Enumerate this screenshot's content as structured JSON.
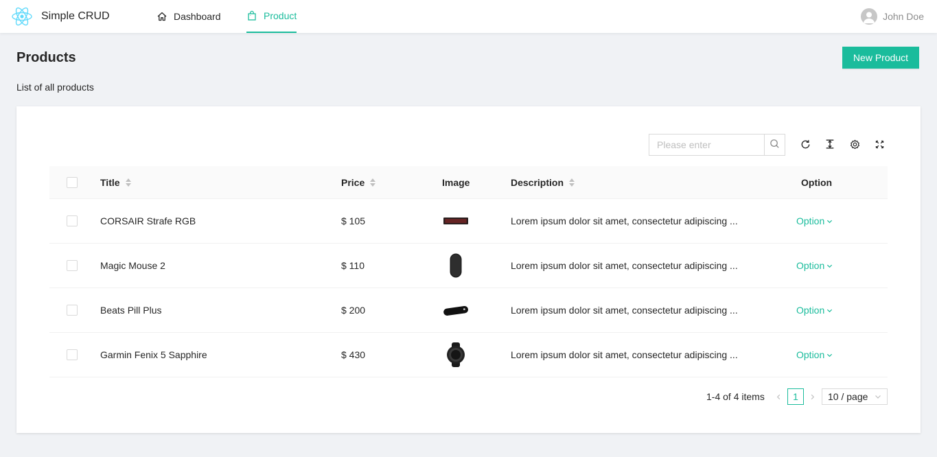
{
  "header": {
    "app_title": "Simple CRUD",
    "logo_icon": "react-atom-icon",
    "nav": [
      {
        "label": "Dashboard",
        "icon": "home-icon",
        "active": false
      },
      {
        "label": "Product",
        "icon": "shopping-bag-icon",
        "active": true
      }
    ],
    "user_name": "John Doe"
  },
  "page": {
    "title": "Products",
    "subtitle": "List of all products",
    "new_button": "New Product"
  },
  "toolbar": {
    "search_placeholder": "Please enter",
    "icons": [
      "reload-icon",
      "column-height-icon",
      "setting-icon",
      "fullscreen-icon"
    ]
  },
  "table": {
    "columns": [
      "Title",
      "Price",
      "Image",
      "Description",
      "Option"
    ],
    "rows": [
      {
        "title": "CORSAIR Strafe RGB",
        "price": "$ 105",
        "image": "keyboard",
        "description": "Lorem ipsum dolor sit amet, consectetur adipiscing ...",
        "option": "Option"
      },
      {
        "title": "Magic Mouse 2",
        "price": "$ 110",
        "image": "mouse",
        "description": "Lorem ipsum dolor sit amet, consectetur adipiscing ...",
        "option": "Option"
      },
      {
        "title": "Beats Pill Plus",
        "price": "$ 200",
        "image": "speaker",
        "description": "Lorem ipsum dolor sit amet, consectetur adipiscing ...",
        "option": "Option"
      },
      {
        "title": "Garmin Fenix 5 Sapphire",
        "price": "$ 430",
        "image": "watch",
        "description": "Lorem ipsum dolor sit amet, consectetur adipiscing ...",
        "option": "Option"
      }
    ]
  },
  "pagination": {
    "total_text": "1-4 of 4 items",
    "current_page": "1",
    "page_size": "10 / page"
  },
  "colors": {
    "accent": "#1abc9c",
    "background": "#f0f2f5"
  }
}
